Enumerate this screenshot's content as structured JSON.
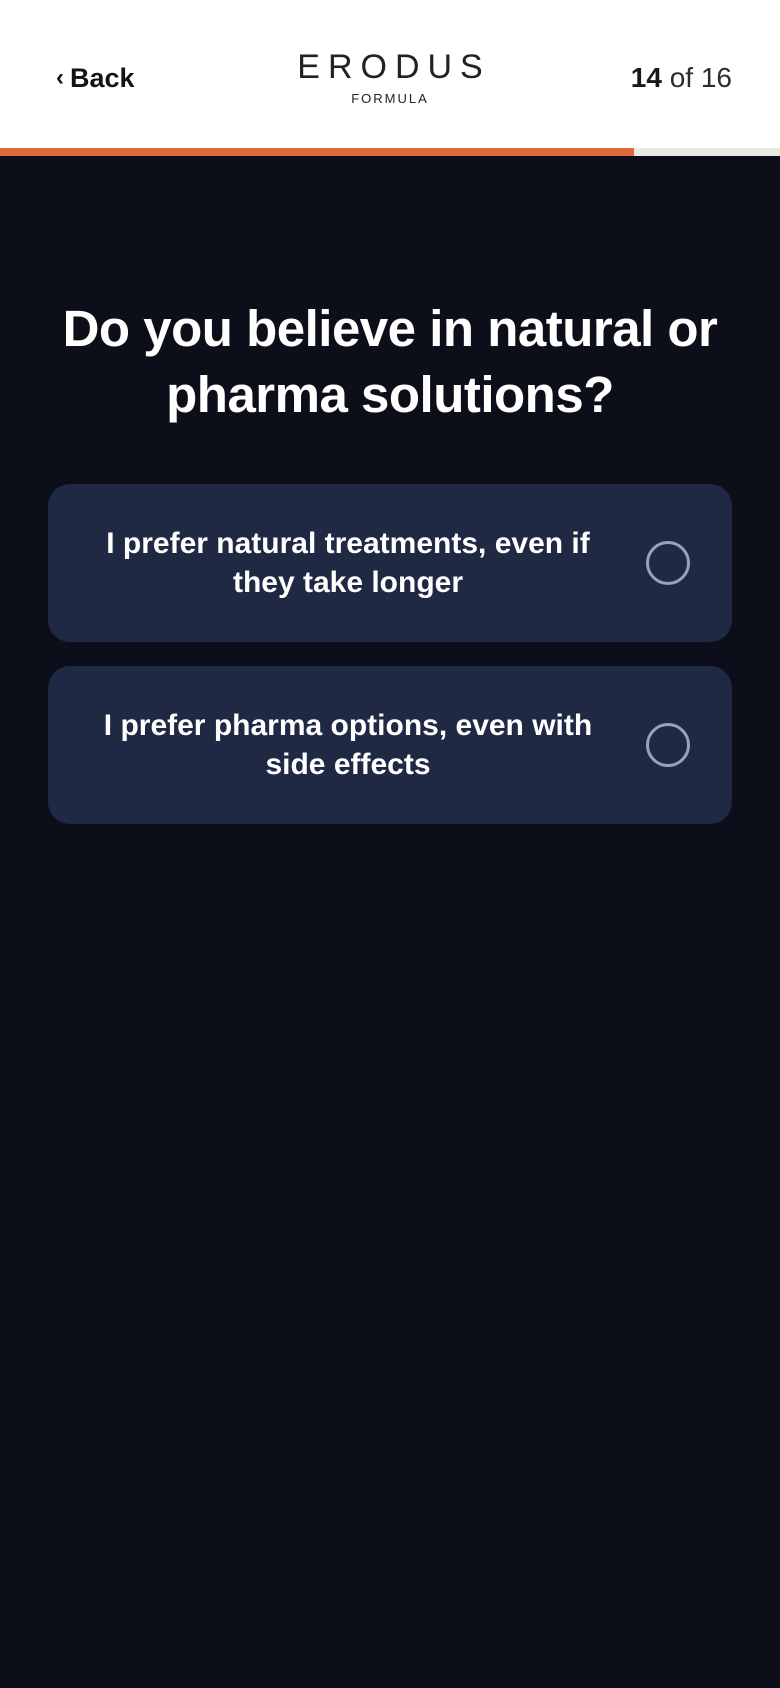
{
  "header": {
    "back_label": "Back",
    "brand": "ERODUS",
    "brand_sub": "FORMULA",
    "step_current": "14",
    "step_of": "of 16",
    "progress": 0.8125
  },
  "question": {
    "title": "Do you believe in natural or pharma solutions?"
  },
  "options": [
    {
      "label": "I prefer natural treatments, even if they take longer",
      "selected": false
    },
    {
      "label": "I prefer pharma options, even with side effects",
      "selected": false
    }
  ],
  "colors": {
    "background": "#0c0e19",
    "card": "#1f2944",
    "accent": "#e0693d",
    "progress_track": "#ece9e4"
  },
  "icons": {
    "back": "chevron-left-icon",
    "option_marker": "radio-circle-icon"
  }
}
